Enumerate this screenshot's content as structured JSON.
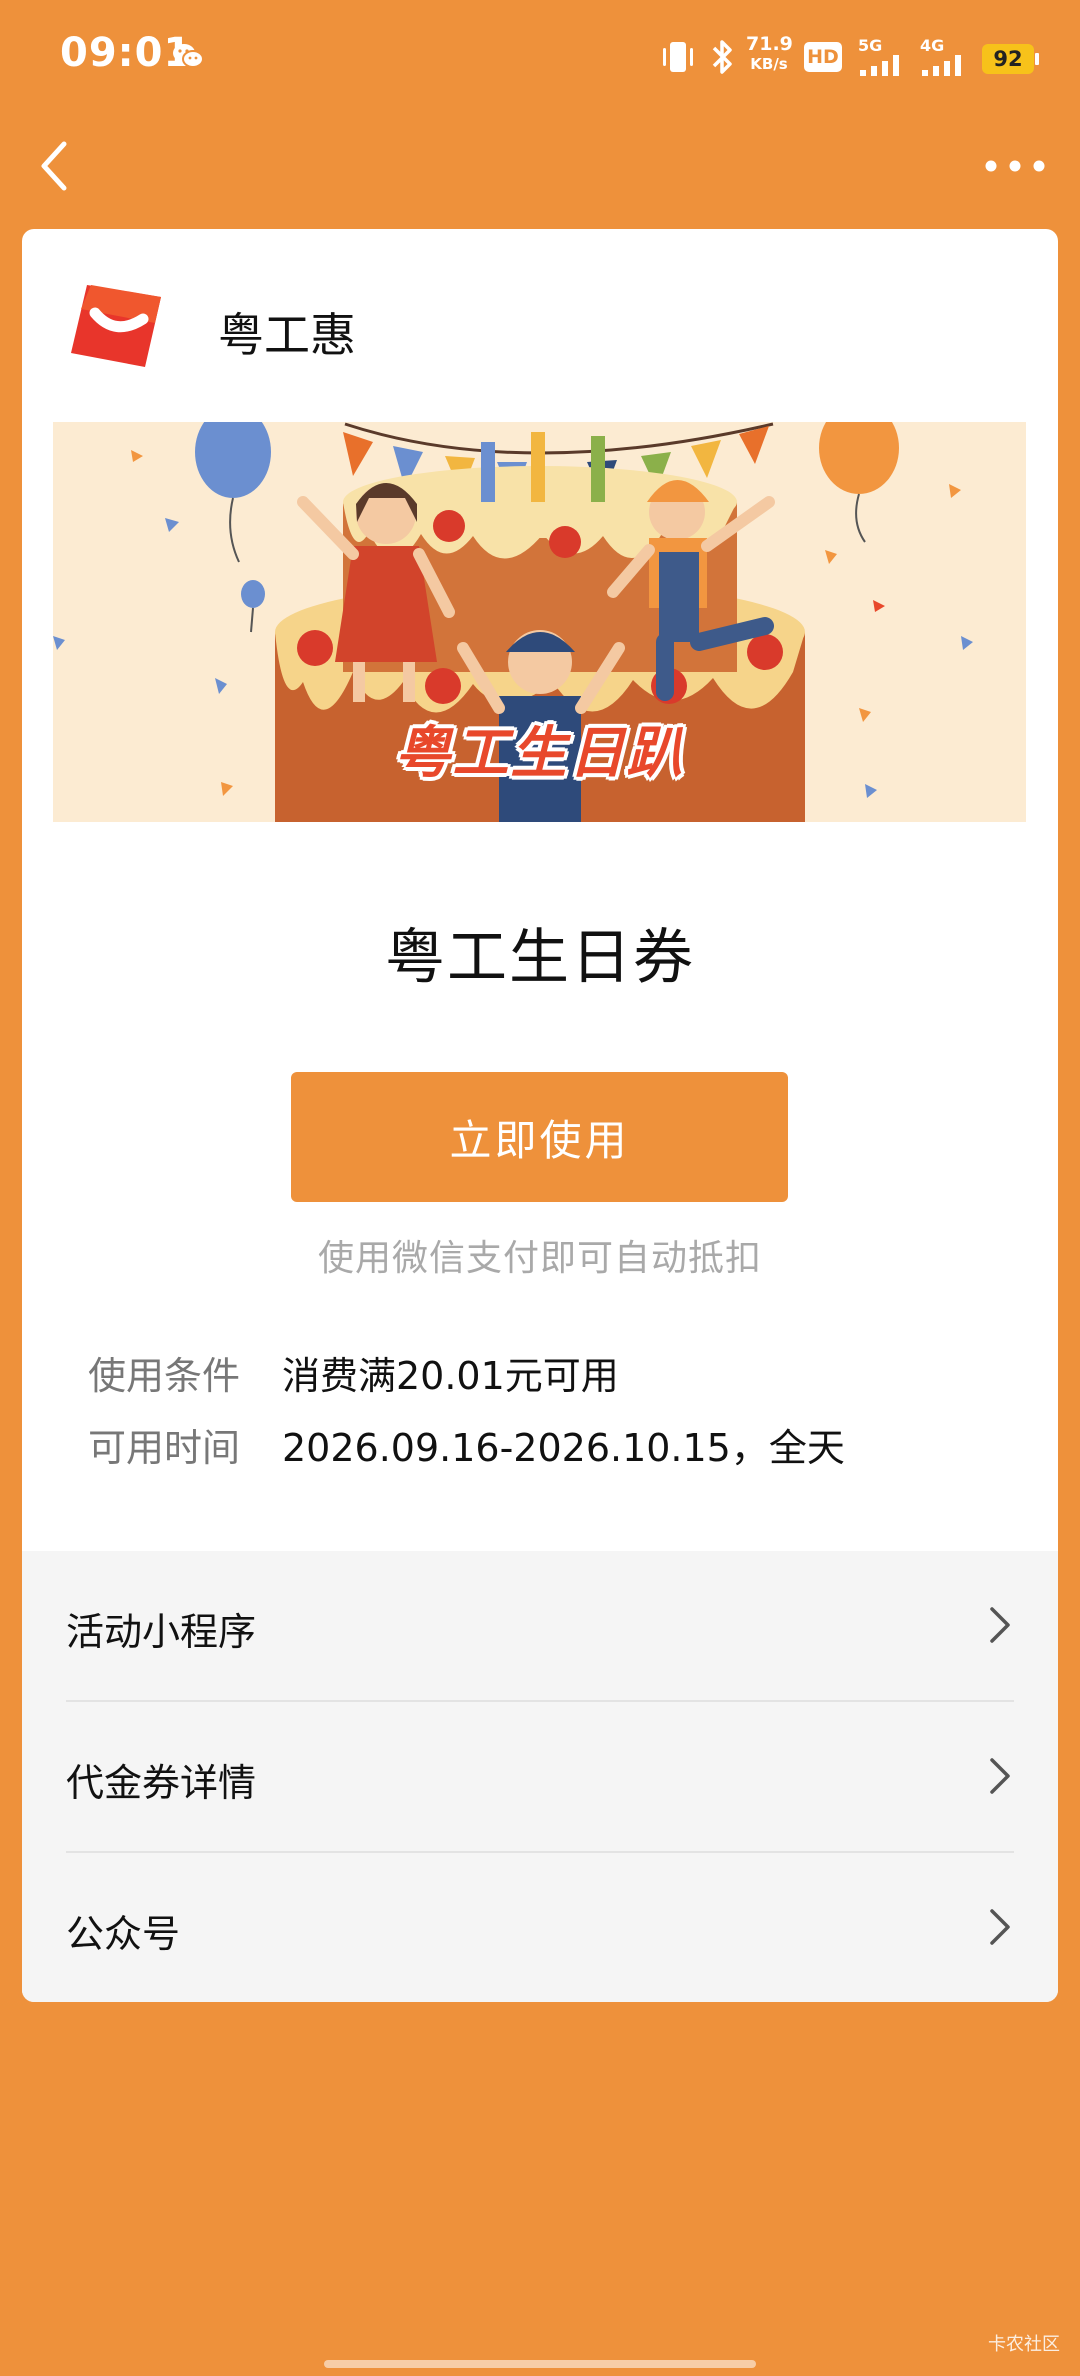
{
  "status_bar": {
    "time": "09:01",
    "net_speed_value": "71.9",
    "net_speed_unit": "KB/s",
    "hd_label": "HD",
    "sim1_label": "5G",
    "sim2_label": "4G",
    "battery": "92"
  },
  "brand": {
    "name": "粤工惠"
  },
  "banner": {
    "text": "粤工生日趴"
  },
  "coupon": {
    "title": "粤工生日券",
    "use_button": "立即使用",
    "hint": "使用微信支付即可自动抵扣",
    "conditions_label": "使用条件",
    "conditions_value": "消费满20.01元可用",
    "time_label": "可用时间",
    "time_value": "2026.09.16-2026.10.15，全天"
  },
  "menu": {
    "items": [
      {
        "label": "活动小程序"
      },
      {
        "label": "代金券详情"
      },
      {
        "label": "公众号"
      }
    ]
  },
  "watermark": "卡农社区",
  "colors": {
    "accent": "#EE913B",
    "card": "#FFFFFF",
    "menu_bg": "#F5F5F5"
  }
}
